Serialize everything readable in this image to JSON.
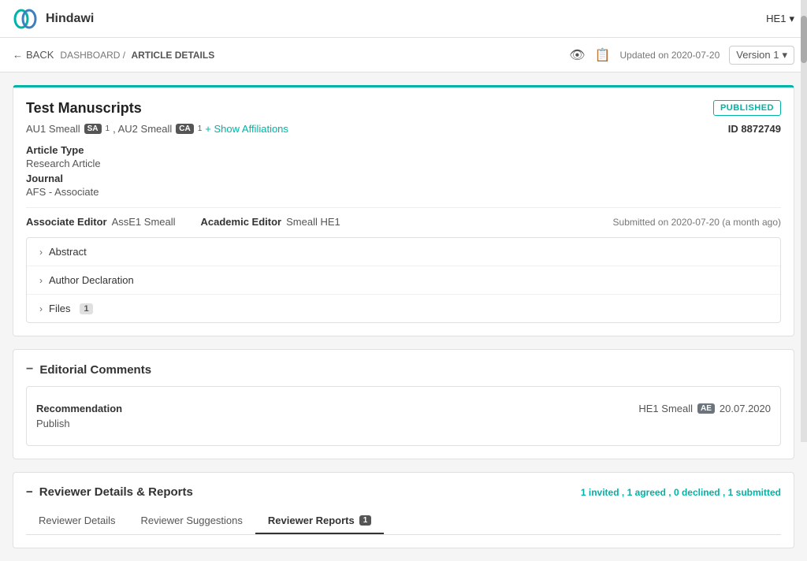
{
  "header": {
    "logo_alt": "Hindawi logo",
    "title": "Hindawi",
    "user": "HE1",
    "chevron": "▾"
  },
  "navbar": {
    "back_label": "BACK",
    "breadcrumb_dashboard": "DASHBOARD /",
    "breadcrumb_current": "ARTICLE DETAILS",
    "updated_label": "Updated on 2020-07-20",
    "version_label": "Version 1",
    "chevron": "▾"
  },
  "article": {
    "title": "Test Manuscripts",
    "status_badge": "PUBLISHED",
    "authors_text": "AU1 Smeall",
    "author1_badge": "SA",
    "author1_sup": "1",
    "authors_mid": ", AU2 Smeall",
    "author2_badge": "CA",
    "author2_sup": "1",
    "show_affiliations": "+ Show Affiliations",
    "article_id_label": "ID 8872749",
    "article_type_label": "Article Type",
    "article_type_value": "Research Article",
    "journal_label": "Journal",
    "journal_value": "AFS - Associate",
    "associate_editor_label": "Associate Editor",
    "associate_editor_value": "AssE1 Smeall",
    "academic_editor_label": "Academic Editor",
    "academic_editor_value": "Smeall HE1",
    "submitted_info": "Submitted on 2020-07-20 (a month ago)",
    "sections": [
      {
        "label": "Abstract"
      },
      {
        "label": "Author Declaration"
      },
      {
        "label": "Files",
        "badge": "1"
      }
    ]
  },
  "editorial_comments": {
    "section_title": "Editorial Comments",
    "recommendation_label": "Recommendation",
    "recommendation_value": "Publish",
    "editor_name": "HE1 Smeall",
    "editor_badge": "AE",
    "date": "20.07.2020"
  },
  "reviewer_section": {
    "section_title": "Reviewer Details & Reports",
    "stats_invited": "1 invited,",
    "stats_agreed": "1 agreed,",
    "stats_declined": "0 declined,",
    "stats_submitted": "1 submitted",
    "tabs": [
      {
        "label": "Reviewer Details",
        "active": false
      },
      {
        "label": "Reviewer Suggestions",
        "active": false
      },
      {
        "label": "Reviewer Reports",
        "active": true,
        "badge": "1"
      }
    ]
  }
}
